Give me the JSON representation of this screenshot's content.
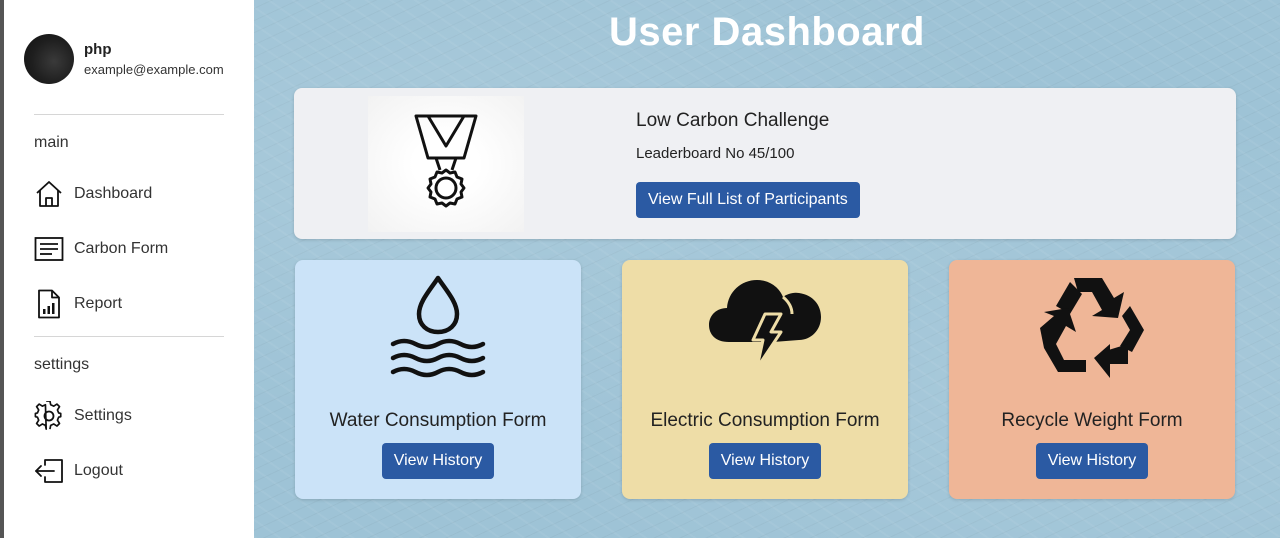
{
  "profile": {
    "name": "php",
    "email": "example@example.com"
  },
  "sidebar": {
    "main_label": "main",
    "settings_label": "settings",
    "items": [
      {
        "label": "Dashboard",
        "icon": "home-icon"
      },
      {
        "label": "Carbon Form",
        "icon": "form-icon"
      },
      {
        "label": "Report",
        "icon": "report-icon"
      },
      {
        "label": "Settings",
        "icon": "gear-icon"
      },
      {
        "label": "Logout",
        "icon": "logout-icon"
      }
    ]
  },
  "page": {
    "title": "User Dashboard"
  },
  "challenge": {
    "title": "Low Carbon Challenge",
    "leaderboard": "Leaderboard No 45/100",
    "button_label": "View Full List of Participants",
    "icon": "medal-icon"
  },
  "tiles": [
    {
      "label": "Water Consumption Form",
      "button_label": "View History",
      "icon": "water-icon",
      "color": "#cbe3f8"
    },
    {
      "label": "Electric Consumption Form",
      "button_label": "View History",
      "icon": "storm-icon",
      "color": "#eedda7"
    },
    {
      "label": "Recycle Weight Form",
      "button_label": "View History",
      "icon": "recycle-icon",
      "color": "#efb697"
    }
  ],
  "colors": {
    "accent": "#2b5aa3",
    "background": "#9ec3d6",
    "card": "#eff0f3"
  }
}
